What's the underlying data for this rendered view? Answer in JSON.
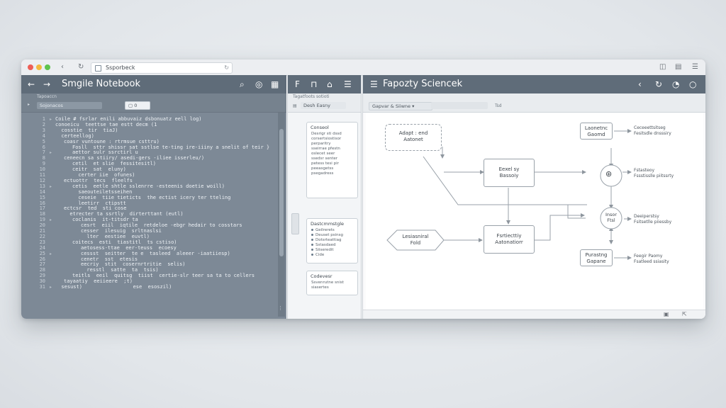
{
  "browser": {
    "url": "Ssporbeck",
    "dot_colors": [
      "#ee5e56",
      "#f3b93f",
      "#5fc44d"
    ]
  },
  "editor": {
    "title": "Smgile Notebook",
    "sub_label": "Tapoaccn",
    "tab_label": "Sojonacos",
    "chip_label": "0",
    "lines": [
      {
        "n": "1",
        "indent": 0,
        "text": "Coile # fsrlar enili abbuvaiz dsbonuatz eell log)"
      },
      {
        "n": "2",
        "indent": 0,
        "text": "conoeicu  teettse tae estt decm (1"
      },
      {
        "n": "3",
        "indent": 0,
        "text": "  cosstie  tir  tiaJ)"
      },
      {
        "n": "4",
        "indent": 0,
        "text": "  certeellog)"
      },
      {
        "n": "5",
        "indent": 1,
        "text": "coasr vuntoune : rtrmsue csttru)"
      },
      {
        "n": "6",
        "indent": 2,
        "text": "Fosll  sttr shissr sat sstlse te-ting ire-iiiny a snelit of teir }"
      },
      {
        "n": "7",
        "indent": 2,
        "text": "aettor sulr ssrctirl u"
      },
      {
        "n": "8",
        "indent": 1,
        "text": "ceneecn sa stiiry/ asedi-gers -iliee isserleu/)"
      },
      {
        "n": "9",
        "indent": 2,
        "text": "cetil  et slie  fessitesitl)"
      },
      {
        "n": "10",
        "indent": 2,
        "text": "ceitr  sat  eluny)"
      },
      {
        "n": "11",
        "indent": 2,
        "text": "  certer iie  ofunes)"
      },
      {
        "n": "12",
        "indent": 1,
        "text": "ectuottr  tecs  fleelfs"
      },
      {
        "n": "13",
        "indent": 2,
        "text": "cetis  eetle shtle sslenrre -esteenis doetie woill)"
      },
      {
        "n": "14",
        "indent": 2,
        "text": "  saeouteiletsseihen"
      },
      {
        "n": "15",
        "indent": 2,
        "text": "  ceseie  tiie tieticts  the ectist icery ter tteling"
      },
      {
        "n": "16",
        "indent": 2,
        "text": "  leetirr  ctipstt"
      },
      {
        "n": "17",
        "indent": 1,
        "text": "ectcsr  ted  sti cose"
      },
      {
        "n": "18",
        "indent": 1,
        "text": "  etrecter ta ssrtly  dirterttant (eutl)"
      },
      {
        "n": "19",
        "indent": 2,
        "text": "coclanis  it-titsdr ta"
      },
      {
        "n": "20",
        "indent": 3,
        "text": "cesrt  eiil  iqtile  retdeloe -ebgr hedair to cosstars"
      },
      {
        "n": "21",
        "indent": 3,
        "text": "cesser  ilesuig  srltnaslsi"
      },
      {
        "n": "22",
        "indent": 3,
        "text": "  lter  eestiee  euvtl)"
      },
      {
        "n": "23",
        "indent": 2,
        "text": "coitecs  esti  tiastitl  ts cstiso)"
      },
      {
        "n": "24",
        "indent": 3,
        "text": "aetosess-ttae  eer-teuss  ecoesy"
      },
      {
        "n": "25",
        "indent": 3,
        "text": "cessst  seitter  te e  tasleed  aleeer -iaatiiesp)"
      },
      {
        "n": "26",
        "indent": 3,
        "text": "cenetr  sst  etesis"
      },
      {
        "n": "27",
        "indent": 3,
        "text": "eecriy  stit  cosernrtritie  selis)"
      },
      {
        "n": "28",
        "indent": 3,
        "text": "  resstl  satte  ta  tsis)"
      },
      {
        "n": "29",
        "indent": 2,
        "text": "teitls  eeil  quitsg  tiist  certie-slr teer sa ta to cellers"
      },
      {
        "n": "30",
        "indent": 1,
        "text": "tayaatiy  eeiieere  ;t)"
      },
      {
        "n": "31",
        "indent": 0,
        "text": "  sesust)                 ese  esoszil)"
      }
    ]
  },
  "middle": {
    "sub_label": "Tagatfoots sotioti",
    "tab_label": "Desh Easny",
    "cards": [
      {
        "title": "Conseol",
        "lines": [
          "Desrigr  sti  dssd",
          "corsertsiostisor",
          "perparitry",
          "sseirrae  pfestn",
          "oslecet  seer",
          "ssedsr  senter",
          "petess  tesi  pir",
          "peeasgetss",
          "psegadress"
        ]
      },
      {
        "title": "Dastcmmstgle",
        "lines": [
          "Geilrerets",
          "Deuset  psinsg",
          "Dotsrteattiag",
          "Sstasdaed",
          "Siiseredit",
          "Cide"
        ]
      },
      {
        "title": "Codevesr",
        "lines": [
          "Ssvenrutne snist",
          "siasertes"
        ]
      }
    ]
  },
  "diagram": {
    "title": "Fapozty Sciencek",
    "sub_dropdown": "Gapvar & Siiwne",
    "sub_label": "Tsd",
    "nodes": {
      "start": [
        "Adapt : end",
        "Aatonet"
      ],
      "center_top": [
        "Eexel sy",
        "Bassoiy"
      ],
      "center_bottom": [
        "Fsrtiecttiy",
        "Aatonatiorr"
      ],
      "hex": [
        "Lesiasniral",
        "Fold"
      ],
      "top_right": [
        "Laonetnc",
        "Gaomd"
      ],
      "circle_mid": [
        "Insor",
        "Ftsl"
      ],
      "bottom_right": [
        "Purastng",
        "Gapane"
      ]
    },
    "notes": [
      [
        "Ceceeettsitseg",
        "Fesitsdle  dnsssiry"
      ],
      [
        "Fstasteoy",
        "Fssstisslle  piitssrty"
      ],
      [
        "Deeiperstsy",
        "Fsitsetlle  piiessby"
      ],
      [
        "Feegir  Paomy",
        "Fsatleed  ssiasity"
      ]
    ]
  },
  "colors": {
    "editor_bg": "#7d8996",
    "titlebar_bg": "#5f6c79",
    "accent_arrow": "#9aa2aa"
  }
}
